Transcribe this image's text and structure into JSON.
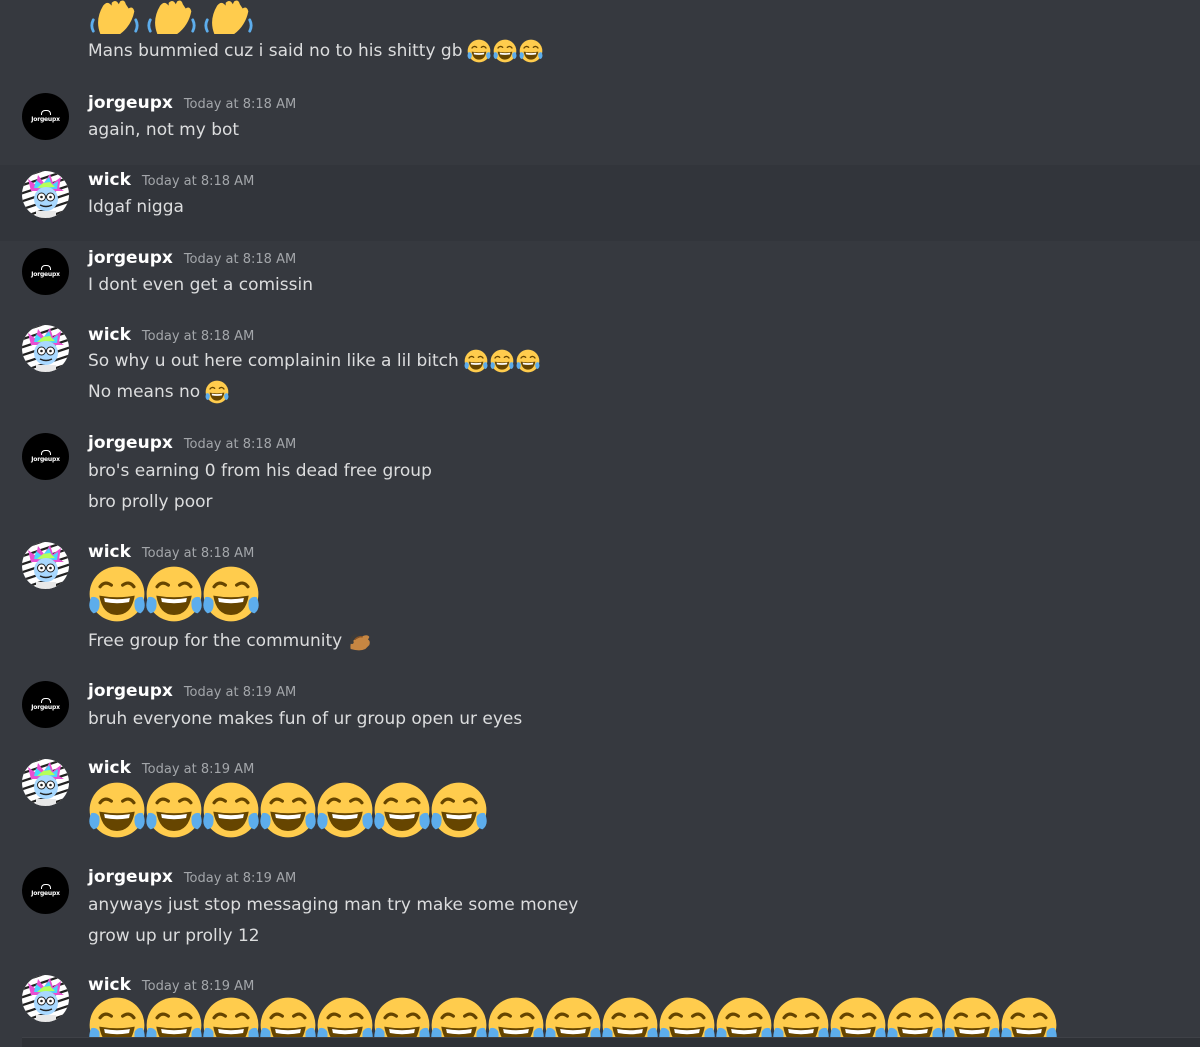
{
  "messages": [
    {
      "lines": [
        "Mans bummied cuz i said no to his shitty gb"
      ]
    },
    {
      "author": "jorgeupx",
      "timestamp": "Today at 8:18 AM",
      "lines": [
        "again, not my bot"
      ]
    },
    {
      "author": "wick",
      "timestamp": "Today at 8:18 AM",
      "lines": [
        "Idgaf nigga"
      ]
    },
    {
      "author": "jorgeupx",
      "timestamp": "Today at 8:18 AM",
      "lines": [
        "I dont even get a comissin"
      ]
    },
    {
      "author": "wick",
      "timestamp": "Today at 8:18 AM",
      "lines": [
        "So why u out here complainin like a lil bitch",
        "No means no"
      ]
    },
    {
      "author": "jorgeupx",
      "timestamp": "Today at 8:18 AM",
      "lines": [
        "bro's earning 0 from his dead free group",
        "bro prolly poor"
      ]
    },
    {
      "author": "wick",
      "timestamp": "Today at 8:18 AM",
      "lines": [
        "Free group for the community"
      ]
    },
    {
      "author": "jorgeupx",
      "timestamp": "Today at 8:19 AM",
      "lines": [
        "bruh everyone makes fun of ur group open ur eyes"
      ]
    },
    {
      "author": "wick",
      "timestamp": "Today at 8:19 AM",
      "lines": []
    },
    {
      "author": "jorgeupx",
      "timestamp": "Today at 8:19 AM",
      "lines": [
        "anyways just stop messaging man try make some money",
        "grow up ur prolly 12"
      ]
    },
    {
      "author": "wick",
      "timestamp": "Today at 8:19 AM",
      "lines": []
    }
  ],
  "avatar_logo_text": "Jorgeupx",
  "icons": {
    "joy": "face-with-tears-of-joy-emoji",
    "wave": "waving-hand-emoji",
    "hand": "hand-gesture-emoji"
  },
  "colors": {
    "background": "#36393f",
    "highlight_row": "#32353b",
    "username": "#ffffff",
    "message_text": "#dcddde",
    "timestamp": "#a3a6aa"
  }
}
